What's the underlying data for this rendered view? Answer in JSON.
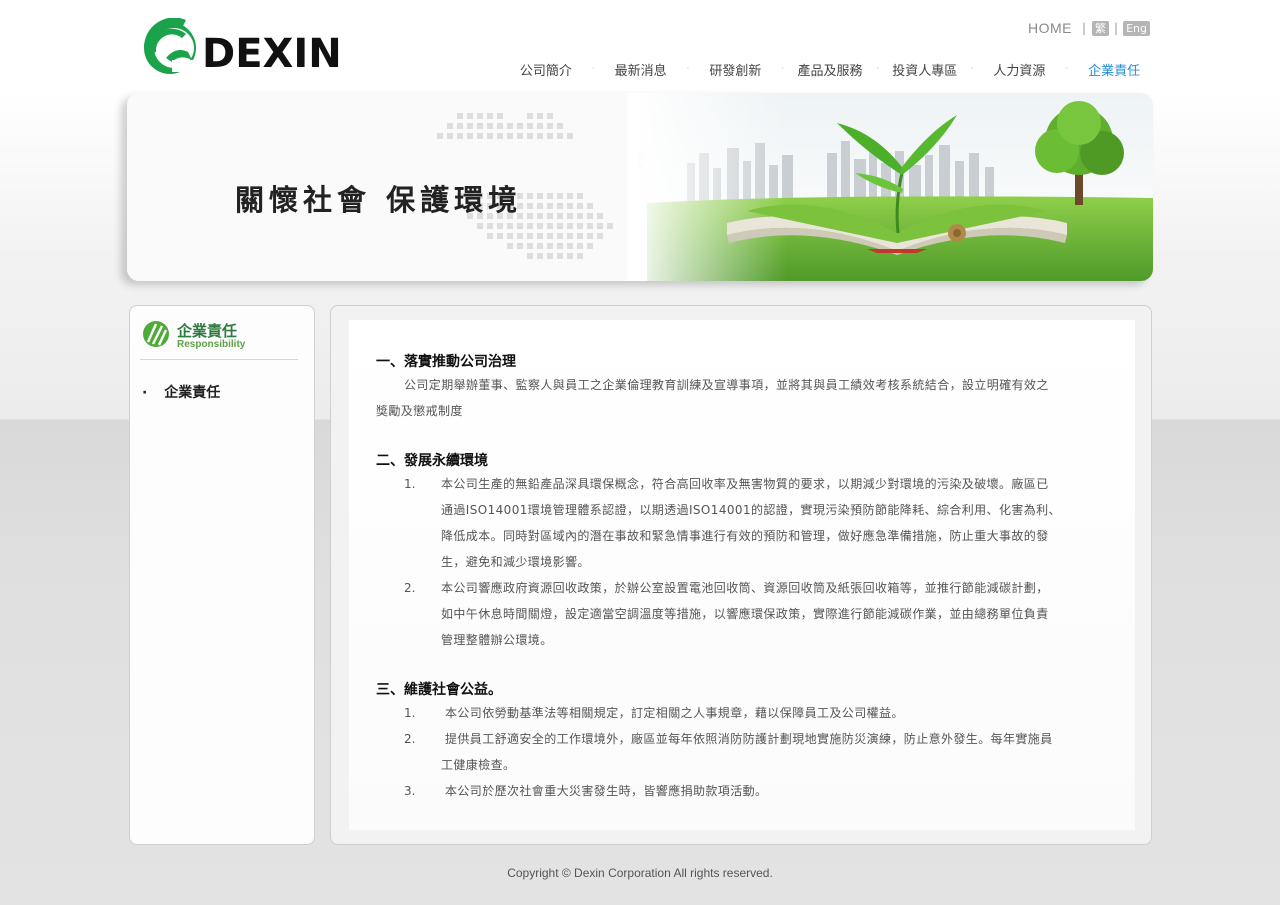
{
  "brand": {
    "name": "DEXIN",
    "green": "#1aa34a",
    "dark": "#111111"
  },
  "top_links": {
    "home": "HOME",
    "lang_tc": "繁",
    "lang_en": "Eng"
  },
  "nav": {
    "items": [
      "公司簡介",
      "最新消息",
      "研發創新",
      "產品及服務",
      "投資人專區",
      "人力資源",
      "企業責任"
    ],
    "active_index": 6,
    "active_color": "#2a8ecf"
  },
  "banner": {
    "title": "關懷社會 保護環境"
  },
  "sidebar": {
    "title_zh": "企業責任",
    "title_en": "Responsibility",
    "items": [
      {
        "bullet": "·",
        "label": "企業責任"
      }
    ]
  },
  "content": {
    "sections": [
      {
        "title": "一、落實推動公司治理",
        "paragraph_line1": "公司定期舉辦董事、監察人與員工之企業倫理教育訓練及宣導事項，並將其與員工績效考核系統結合，設立明確有效之",
        "paragraph_line2": "獎勵及懲戒制度"
      },
      {
        "title": "二、發展永續環境",
        "items": [
          {
            "num": "1.",
            "lines": [
              "本公司生產的無鉛產品深具環保概念，符合高回收率及無害物質的要求，以期減少對環境的污染及破壞。廠區已",
              "通過ISO14001環境管理體系認證，以期透過ISO14001的認證，實現污染預防節能降耗、綜合利用、化害為利、",
              "降低成本。同時對區域內的潛在事故和緊急情事進行有效的預防和管理，做好應急準備措施，防止重大事故的發",
              "生，避免和減少環境影響。"
            ]
          },
          {
            "num": "2.",
            "lines": [
              "本公司響應政府資源回收政策，於辦公室設置電池回收筒、資源回收筒及紙張回收箱等，並推行節能減碳計劃，",
              "如中午休息時間關燈，設定適當空調溫度等措施，以響應環保政策，實際進行節能減碳作業，並由總務單位負責",
              "管理整體辦公環境。"
            ]
          }
        ]
      },
      {
        "title": "三、維護社會公益。",
        "items": [
          {
            "num": "1.",
            "lines": [
              "本公司依勞動基準法等相關規定，訂定相關之人事規章，藉以保障員工及公司權益。"
            ]
          },
          {
            "num": "2.",
            "lines": [
              "提供員工舒適安全的工作環境外，廠區並每年依照消防防護計劃現地實施防災演練，防止意外發生。每年實施員",
              "工健康檢查。"
            ]
          },
          {
            "num": "3.",
            "lines": [
              "本公司於歷次社會重大災害發生時，皆響應捐助款項活動。"
            ]
          }
        ]
      }
    ]
  },
  "footer": {
    "copyright": "Copyright © Dexin Corporation All rights reserved."
  }
}
